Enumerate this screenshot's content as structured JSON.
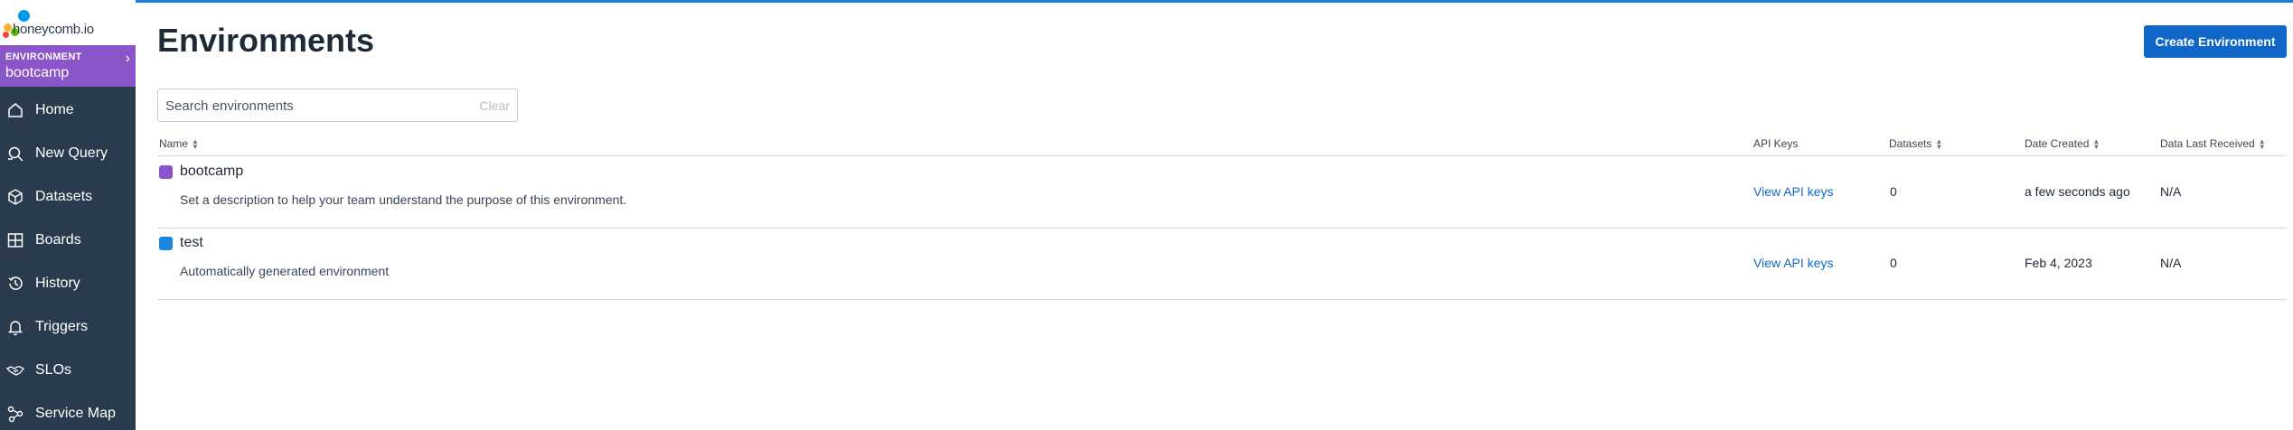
{
  "brand": {
    "wordmark": "honeycomb.io"
  },
  "environment_switcher": {
    "label": "ENVIRONMENT",
    "value": "bootcamp"
  },
  "nav": [
    {
      "label": "Home",
      "icon": "home-icon"
    },
    {
      "label": "New Query",
      "icon": "query-icon"
    },
    {
      "label": "Datasets",
      "icon": "cube-icon"
    },
    {
      "label": "Boards",
      "icon": "boards-icon"
    },
    {
      "label": "History",
      "icon": "history-icon"
    },
    {
      "label": "Triggers",
      "icon": "bell-icon"
    },
    {
      "label": "SLOs",
      "icon": "handshake-icon"
    },
    {
      "label": "Service Map",
      "icon": "service-map-icon"
    }
  ],
  "page": {
    "title": "Environments",
    "create_button": "Create Environment"
  },
  "search": {
    "placeholder": "Search environments",
    "value": "",
    "clear_label": "Clear"
  },
  "table": {
    "headers": {
      "name": "Name",
      "api_keys": "API Keys",
      "datasets": "Datasets",
      "date_created": "Date Created",
      "data_last_received": "Data Last Received"
    },
    "rows": [
      {
        "name": "bootcamp",
        "color": "#8a55c8",
        "description": "Set a description to help your team understand the purpose of this environment.",
        "api_keys": "View API keys",
        "datasets": "0",
        "date_created": "a few seconds ago",
        "data_last_received": "N/A"
      },
      {
        "name": "test",
        "color": "#1a86de",
        "description": "Automatically generated environment",
        "api_keys": "View API keys",
        "datasets": "0",
        "date_created": "Feb 4, 2023",
        "data_last_received": "N/A"
      }
    ]
  },
  "colors": {
    "accent": "#1067c8",
    "sidebar": "#2b3b4e",
    "environment": "#8a55c8",
    "topbar": "#1f7fe0"
  }
}
